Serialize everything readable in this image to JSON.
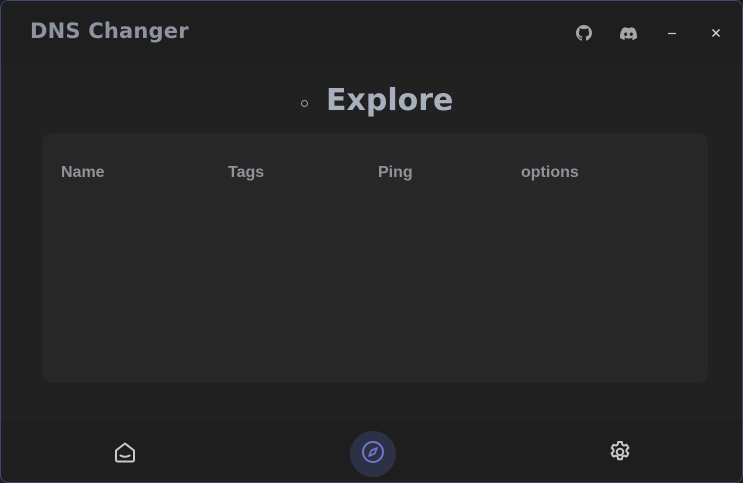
{
  "app": {
    "title": "DNS Changer"
  },
  "titlebar": {
    "icons": [
      "github-icon",
      "discord-icon",
      "minimize-icon",
      "close-icon"
    ]
  },
  "page": {
    "heading": "Explore"
  },
  "table": {
    "columns": [
      "Name",
      "Tags",
      "Ping",
      "options"
    ]
  },
  "nav": {
    "items": [
      {
        "icon": "home-icon",
        "active": false
      },
      {
        "icon": "compass-icon",
        "active": true
      },
      {
        "icon": "gear-icon",
        "active": false
      }
    ]
  },
  "colors": {
    "background": "#212121",
    "panel": "#272727",
    "accent": "#6f75c8",
    "active_nav_bg": "#2d3146",
    "text_muted": "#8f949b",
    "window_border": "#3a4a72"
  }
}
